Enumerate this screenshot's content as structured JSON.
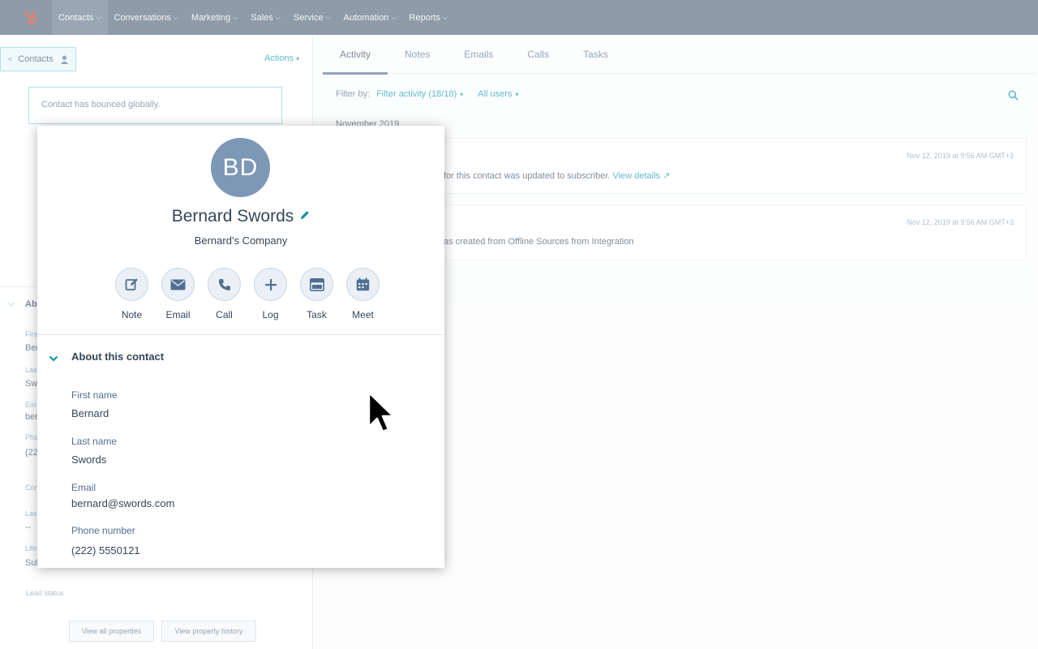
{
  "nav": {
    "items": [
      {
        "label": "Contacts"
      },
      {
        "label": "Conversations"
      },
      {
        "label": "Marketing"
      },
      {
        "label": "Sales"
      },
      {
        "label": "Service"
      },
      {
        "label": "Automation"
      },
      {
        "label": "Reports"
      }
    ],
    "brand_color": "#f5f8fa",
    "bar_color": "#8f9ba8"
  },
  "left": {
    "back_label": "Contacts",
    "actions_label": "Actions",
    "bounce_text": "Contact has bounced globally.",
    "fragments": [
      "Ab",
      "First",
      "Ber",
      "Las",
      "Sw",
      "Em",
      "ber",
      "Pho",
      "(22",
      "Con",
      "Las",
      "--",
      "Life",
      "Sub"
    ],
    "lead_status": "Lead status",
    "view_all_properties": "View all properties",
    "view_property_history": "View property history"
  },
  "tabs": [
    {
      "label": "Activity"
    },
    {
      "label": "Notes"
    },
    {
      "label": "Emails"
    },
    {
      "label": "Calls"
    },
    {
      "label": "Tasks"
    }
  ],
  "filter": {
    "label": "Filter by:",
    "activity": "Filter activity (18/18)",
    "users": "All users"
  },
  "timeline": {
    "month": "November 2019",
    "events": [
      {
        "time": "Nov 12, 2019 at 9:56 AM GMT+3",
        "text": "for this contact was updated to subscriber.",
        "link": "View details"
      },
      {
        "time": "Nov 12, 2019 at 9:56 AM GMT+3",
        "text": "as created from Offline Sources from Integration"
      }
    ]
  },
  "contact": {
    "initials": "BD",
    "name": "Bernard Swords",
    "company": "Bernard’s Company",
    "actions": [
      {
        "label": "Note",
        "icon": "note-icon"
      },
      {
        "label": "Email",
        "icon": "email-icon"
      },
      {
        "label": "Call",
        "icon": "phone-icon"
      },
      {
        "label": "Log",
        "icon": "plus-icon"
      },
      {
        "label": "Task",
        "icon": "task-icon"
      },
      {
        "label": "Meet",
        "icon": "calendar-icon"
      }
    ],
    "about_title": "About this contact",
    "properties": [
      {
        "label": "First name",
        "value": "Bernard"
      },
      {
        "label": "Last name",
        "value": "Swords"
      },
      {
        "label": "Email",
        "value": "bernard@swords.com"
      },
      {
        "label": "Phone number",
        "value": "(222) 5550121"
      }
    ]
  },
  "colors": {
    "accent": "#0091ae",
    "avatar": "#7c98b6",
    "text": "#33475b"
  }
}
